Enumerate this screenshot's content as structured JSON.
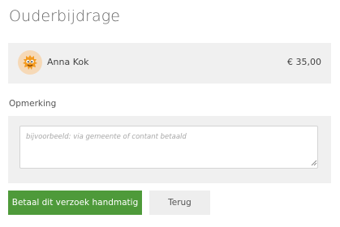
{
  "page": {
    "title": "Ouderbijdrage"
  },
  "payer": {
    "name": "Anna Kok",
    "amount": "€ 35,00",
    "avatar_icon": "orange-monster-avatar-icon"
  },
  "remark": {
    "label": "Opmerking",
    "placeholder": "bijvoorbeeld: via gemeente of contant betaald",
    "value": ""
  },
  "actions": {
    "pay_manual_label": "Betaal dit verzoek handmatig",
    "back_label": "Terug"
  },
  "colors": {
    "primary_button": "#4e9a3a",
    "secondary_button": "#eeeeee",
    "panel_background": "#f0f0f0"
  }
}
